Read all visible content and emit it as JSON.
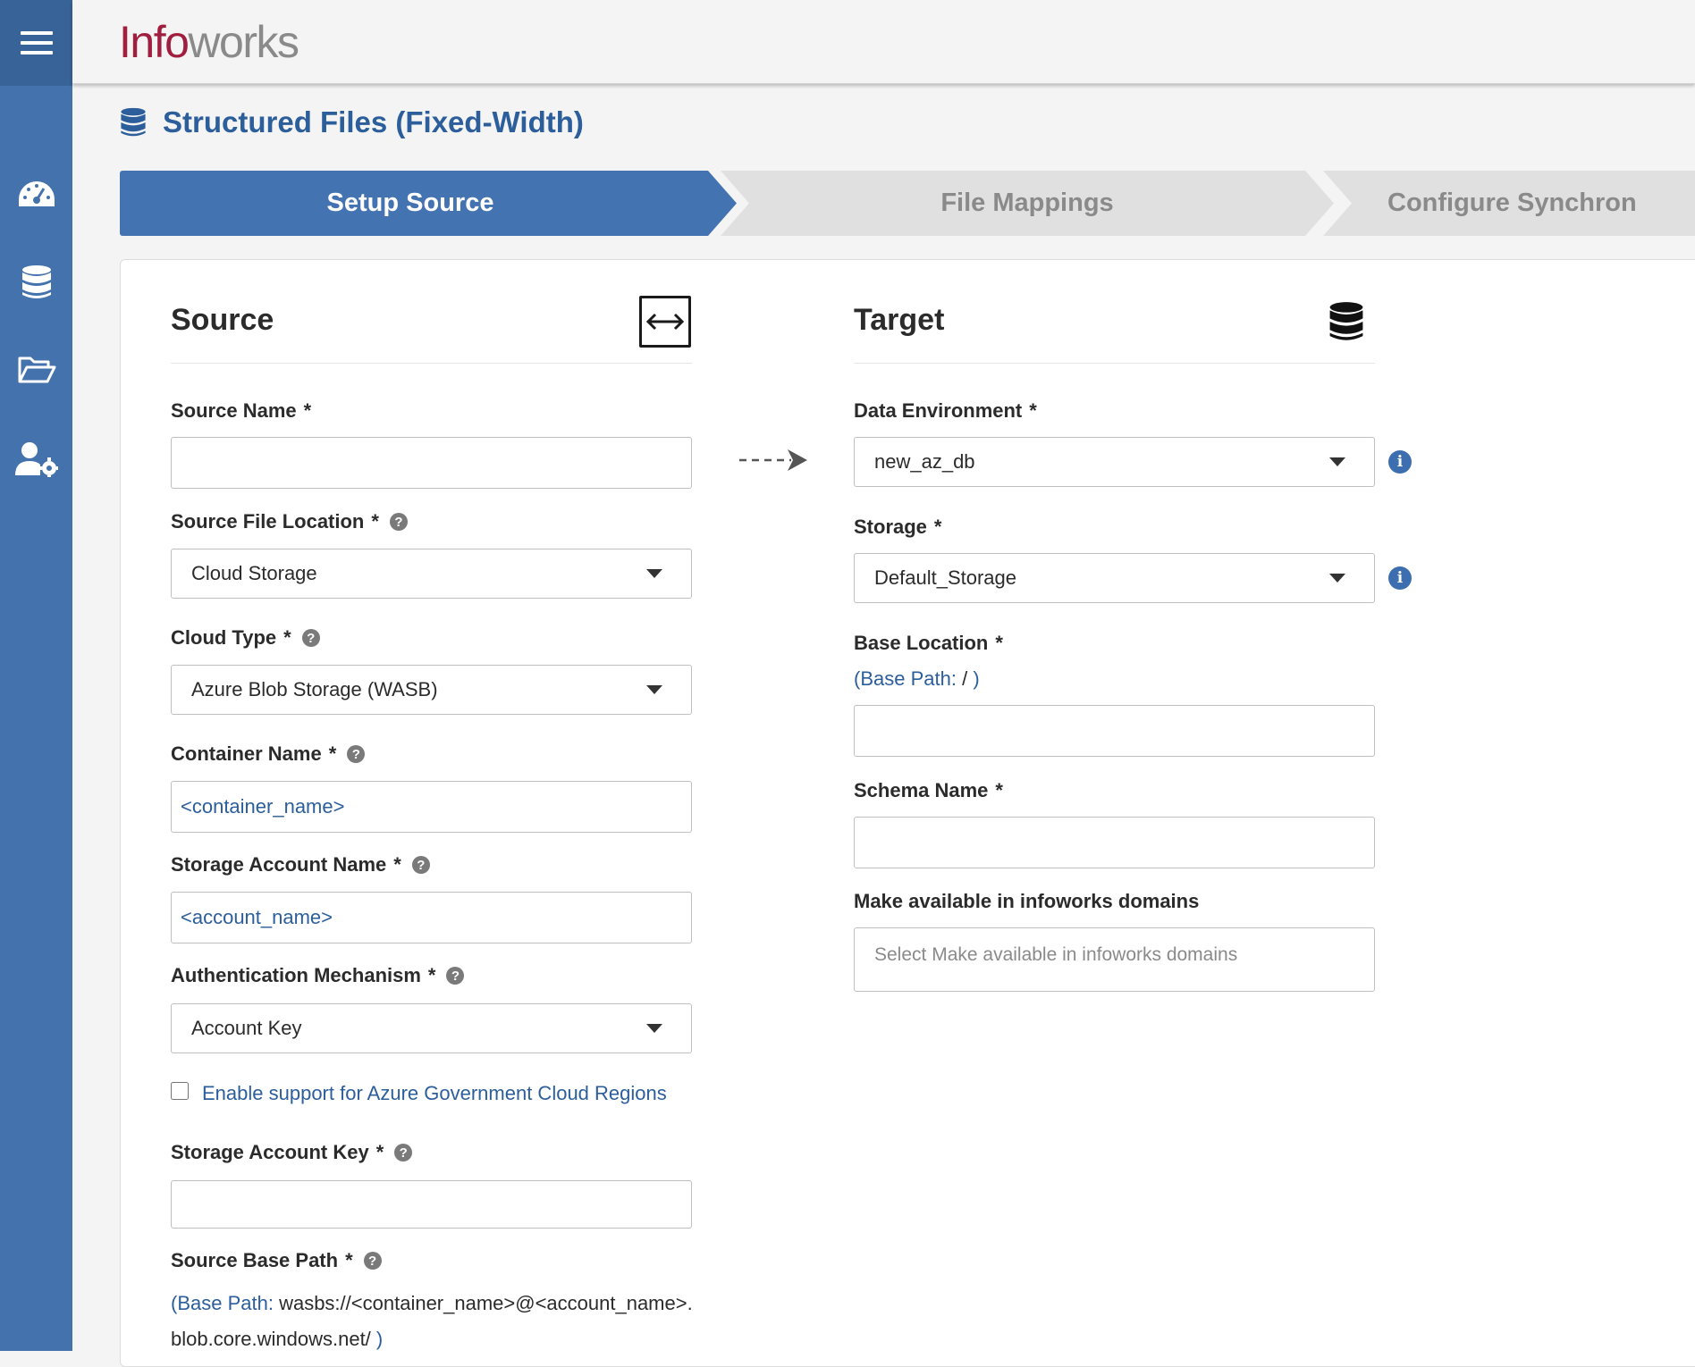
{
  "app": {
    "logo_part1": "Info",
    "logo_part2": "works"
  },
  "sidebar": {
    "items": [
      {
        "name": "dashboard",
        "icon": "gauge-icon"
      },
      {
        "name": "sources",
        "icon": "database-icon"
      },
      {
        "name": "domains",
        "icon": "folder-open-icon"
      },
      {
        "name": "admin",
        "icon": "user-gear-icon"
      }
    ]
  },
  "page": {
    "title": "Structured Files (Fixed-Width)"
  },
  "stepper": {
    "steps": [
      "Setup Source",
      "File Mappings",
      "Configure Synchron"
    ]
  },
  "source": {
    "title": "Source",
    "source_name_label": "Source Name",
    "source_name_value": "",
    "file_location_label": "Source File Location",
    "file_location_value": "Cloud Storage",
    "cloud_type_label": "Cloud Type",
    "cloud_type_value": "Azure Blob Storage (WASB)",
    "container_label": "Container Name",
    "container_value": "<container_name>",
    "account_name_label": "Storage Account Name",
    "account_name_value": "<account_name>",
    "auth_label": "Authentication Mechanism",
    "auth_value": "Account Key",
    "gov_cloud_label": "Enable support for Azure Government Cloud Regions",
    "account_key_label": "Storage Account Key",
    "account_key_value": "",
    "base_path_label": "Source Base Path",
    "base_path_prefix": "(Base Path: ",
    "base_path_line1": "wasbs://<container_name>@<account_name>.",
    "base_path_line2": "blob.core.windows.net/",
    "base_path_suffix": " )"
  },
  "target": {
    "title": "Target",
    "data_env_label": "Data Environment",
    "data_env_value": "new_az_db",
    "storage_label": "Storage",
    "storage_value": "Default_Storage",
    "base_location_label": "Base Location",
    "base_location_hint_prefix": "(Base Path: ",
    "base_location_hint_value": "/",
    "base_location_hint_suffix": " )",
    "base_location_value": "",
    "schema_label": "Schema Name",
    "schema_value": "",
    "domains_label": "Make available in infoworks domains",
    "domains_placeholder": "Select Make available in infoworks domains"
  },
  "common": {
    "required_mark": "*",
    "help_glyph": "?",
    "info_glyph": "i"
  },
  "colors": {
    "sidebar": "#4472ad",
    "primary": "#4373b0",
    "brand_red": "#a01f3e"
  }
}
